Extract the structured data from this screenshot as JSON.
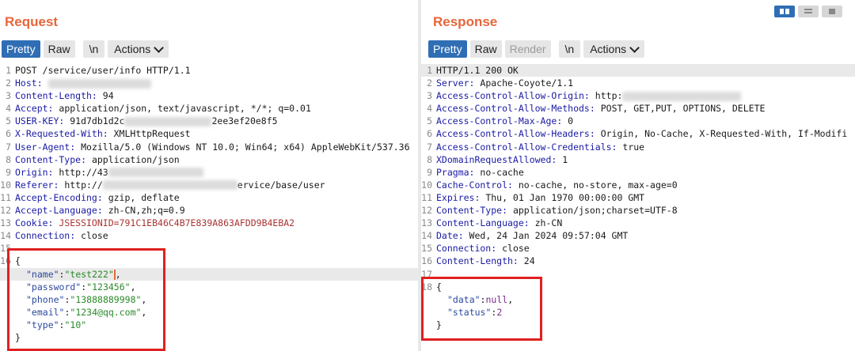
{
  "request": {
    "title": "Request",
    "tabs": {
      "pretty": "Pretty",
      "raw": "Raw",
      "newline": "\\n",
      "actions": "Actions"
    },
    "lines": [
      {
        "n": "1",
        "text": "POST /service/user/info HTTP/1.1"
      },
      {
        "n": "2",
        "key": "Host:",
        "val": " "
      },
      {
        "n": "3",
        "key": "Content-Length:",
        "val": " 94"
      },
      {
        "n": "4",
        "key": "Accept:",
        "val": " application/json, text/javascript, */*; q=0.01"
      },
      {
        "n": "5",
        "key": "USER-KEY:",
        "val": " 91d7db1d2c",
        "tail": "2ee3ef20e8f5"
      },
      {
        "n": "6",
        "key": "X-Requested-With:",
        "val": " XMLHttpRequest"
      },
      {
        "n": "7",
        "key": "User-Agent:",
        "val": " Mozilla/5.0 (Windows NT 10.0; Win64; x64) AppleWebKit/537.36"
      },
      {
        "n": "8",
        "key": "Content-Type:",
        "val": " application/json"
      },
      {
        "n": "9",
        "key": "Origin:",
        "val": " http://43"
      },
      {
        "n": "10",
        "key": "Referer:",
        "val": " http://",
        "tail": "ervice/base/user"
      },
      {
        "n": "11",
        "key": "Accept-Encoding:",
        "val": " gzip, deflate"
      },
      {
        "n": "12",
        "key": "Accept-Language:",
        "val": " zh-CN,zh;q=0.9"
      },
      {
        "n": "13",
        "key": "Cookie:",
        "val": " JSESSIONID=791C1EB46C4B7E839A863AFDD9B4EBA2"
      },
      {
        "n": "14",
        "key": "Connection:",
        "val": " close"
      },
      {
        "n": "15",
        "text": ""
      },
      {
        "n": "16",
        "text": "{"
      },
      {
        "n": "",
        "jkey": "\"name\"",
        "jval": "\"test222\"",
        "suffix": ","
      },
      {
        "n": "",
        "jkey": "\"password\"",
        "jval": "\"123456\"",
        "suffix": ","
      },
      {
        "n": "",
        "jkey": "\"phone\"",
        "jval": "\"13888889998\"",
        "suffix": ","
      },
      {
        "n": "",
        "jkey": "\"email\"",
        "jval": "\"1234@qq.com\"",
        "suffix": ","
      },
      {
        "n": "",
        "jkey": "\"type\"",
        "jval": "\"10\"",
        "suffix": ""
      },
      {
        "n": "",
        "text": "}"
      }
    ]
  },
  "response": {
    "title": "Response",
    "tabs": {
      "pretty": "Pretty",
      "raw": "Raw",
      "render": "Render",
      "newline": "\\n",
      "actions": "Actions"
    },
    "lines": [
      {
        "n": "1",
        "text": "HTTP/1.1 200 OK"
      },
      {
        "n": "2",
        "key": "Server:",
        "val": " Apache-Coyote/1.1"
      },
      {
        "n": "3",
        "key": "Access-Control-Allow-Origin:",
        "val": " http:"
      },
      {
        "n": "4",
        "key": "Access-Control-Allow-Methods:",
        "val": " POST, GET,PUT, OPTIONS, DELETE"
      },
      {
        "n": "5",
        "key": "Access-Control-Max-Age:",
        "val": " 0"
      },
      {
        "n": "6",
        "key": "Access-Control-Allow-Headers:",
        "val": " Origin, No-Cache, X-Requested-With, If-Modifi"
      },
      {
        "n": "7",
        "key": "Access-Control-Allow-Credentials:",
        "val": " true"
      },
      {
        "n": "8",
        "key": "XDomainRequestAllowed:",
        "val": " 1"
      },
      {
        "n": "9",
        "key": "Pragma:",
        "val": " no-cache"
      },
      {
        "n": "10",
        "key": "Cache-Control:",
        "val": " no-cache, no-store, max-age=0"
      },
      {
        "n": "11",
        "key": "Expires:",
        "val": " Thu, 01 Jan 1970 00:00:00 GMT"
      },
      {
        "n": "12",
        "key": "Content-Type:",
        "val": " application/json;charset=UTF-8"
      },
      {
        "n": "13",
        "key": "Content-Language:",
        "val": " zh-CN"
      },
      {
        "n": "14",
        "key": "Date:",
        "val": " Wed, 24 Jan 2024 09:57:04 GMT"
      },
      {
        "n": "15",
        "key": "Connection:",
        "val": " close"
      },
      {
        "n": "16",
        "key": "Content-Length:",
        "val": " 24"
      },
      {
        "n": "17",
        "text": ""
      },
      {
        "n": "18",
        "text": "{"
      },
      {
        "n": "",
        "jkey": "\"data\"",
        "jval": "null",
        "suffix": ","
      },
      {
        "n": "",
        "jkey": "\"status\"",
        "jval": "2",
        "suffix": ""
      },
      {
        "n": "",
        "text": "}"
      }
    ]
  },
  "colors": {
    "accent_title": "#e8663a",
    "tab_active": "#2f6eb4",
    "highlight_box": "#e02020"
  }
}
